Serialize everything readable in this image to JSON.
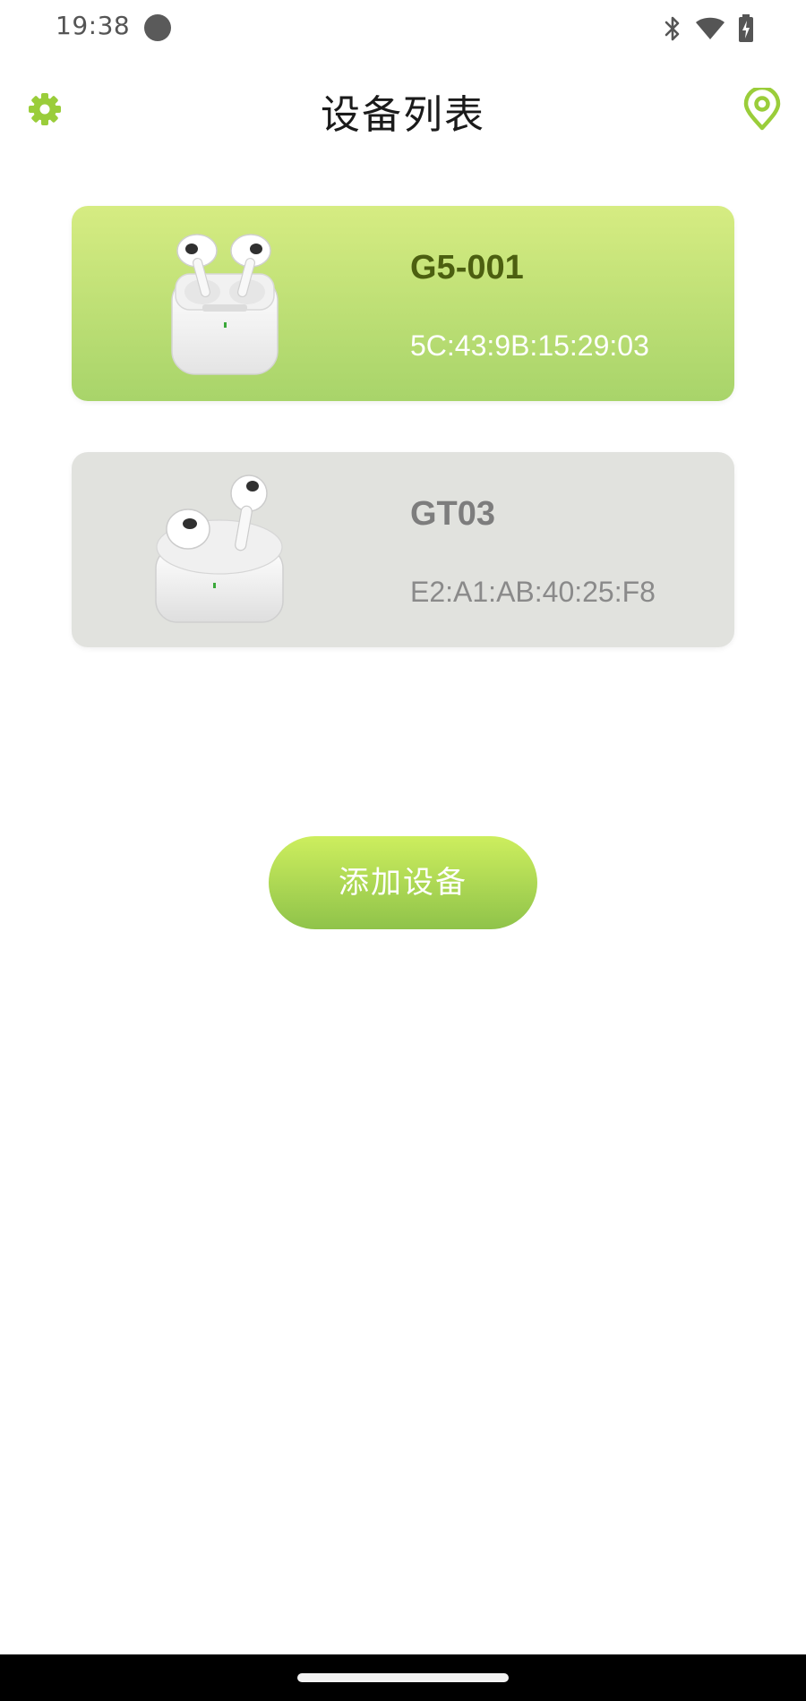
{
  "status_bar": {
    "time": "19:38"
  },
  "header": {
    "title": "设备列表",
    "left_icon": "gear-icon",
    "right_icon": "location-pin-icon"
  },
  "devices": [
    {
      "name": "G5-001",
      "mac": "5C:43:9B:15:29:03",
      "state": "selected",
      "image": "earbuds-pro-case"
    },
    {
      "name": "GT03",
      "mac": "E2:A1:AB:40:25:F8",
      "state": "unselected",
      "image": "earbuds-case"
    }
  ],
  "add_button": {
    "label": "添加设备"
  },
  "colors": {
    "accent": "#9acd3a",
    "card_selected_top": "#d6ec82",
    "card_selected_bottom": "#a8d46a",
    "card_unselected": "#e1e2de"
  }
}
